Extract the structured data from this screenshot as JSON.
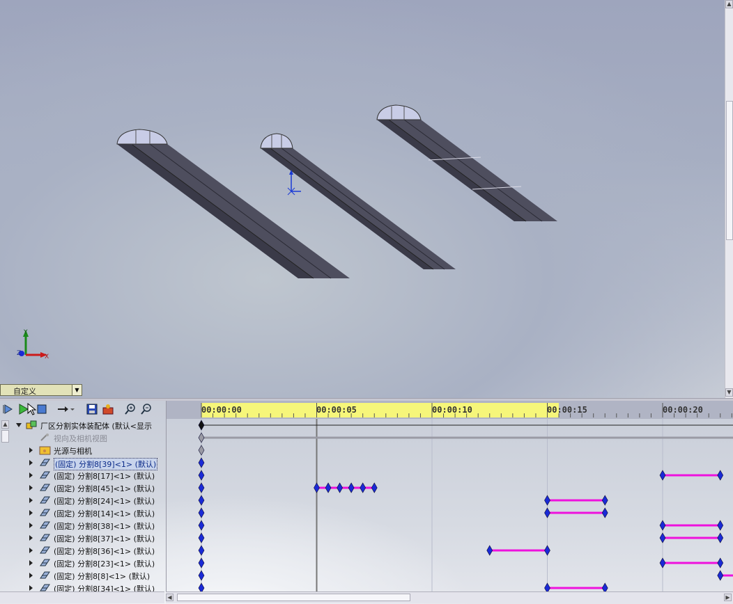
{
  "viewport": {
    "config_selector": "自定义",
    "triad_axes": [
      "Y",
      "X",
      "Z"
    ]
  },
  "motion_toolbar": {
    "buttons": [
      "calculate-icon",
      "play-icon",
      "stop-icon",
      "playback-mode-icon",
      "save-animation-icon",
      "animation-wizard-icon",
      "zoom-in-icon",
      "zoom-out-icon"
    ]
  },
  "tree": {
    "rows": [
      {
        "label": "厂区分割实体装配体 (默认<显示",
        "icon": "assembly-icon",
        "expanded": true
      },
      {
        "label": "视向及相机视图",
        "icon": "camera-view-icon",
        "dimmed": true
      },
      {
        "label": "光源与相机",
        "icon": "lights-folder-icon"
      },
      {
        "label": "(固定) 分割8[39]<1> (默认)",
        "icon": "part-icon",
        "selected": true
      },
      {
        "label": "(固定) 分割8[17]<1> (默认)",
        "icon": "part-icon"
      },
      {
        "label": "(固定) 分割8[45]<1> (默认)",
        "icon": "part-icon"
      },
      {
        "label": "(固定) 分割8[24]<1> (默认)",
        "icon": "part-icon"
      },
      {
        "label": "(固定) 分割8[14]<1> (默认)",
        "icon": "part-icon"
      },
      {
        "label": "(固定) 分割8[38]<1> (默认)",
        "icon": "part-icon"
      },
      {
        "label": "(固定) 分割8[37]<1> (默认)",
        "icon": "part-icon"
      },
      {
        "label": "(固定) 分割8[36]<1> (默认)",
        "icon": "part-icon"
      },
      {
        "label": "(固定) 分割8[23]<1> (默认)",
        "icon": "part-icon"
      },
      {
        "label": "(固定) 分割8[8]<1> (默认)",
        "icon": "part-icon"
      },
      {
        "label": "(固定) 分割8[34]<1> (默认)",
        "icon": "part-icon"
      }
    ]
  },
  "timeline": {
    "tick_labels": [
      "00:00:00",
      "00:00:05",
      "00:00:10",
      "00:00:15",
      "00:00:20"
    ],
    "tick_seconds": [
      0,
      5,
      10,
      15,
      20
    ],
    "visible_range_seconds": [
      0,
      23.1
    ],
    "keyframe_color": "#1a2ad6",
    "bar_color": "#ee11dd",
    "tracks": [
      {
        "keys": [
          0
        ],
        "bars": [],
        "root": true
      },
      {
        "keys": [
          0
        ],
        "bars": [],
        "gray": true
      },
      {
        "keys": [
          0
        ],
        "bars": [],
        "gray": true
      },
      {
        "keys": [
          0
        ],
        "bars": []
      },
      {
        "keys": [
          0,
          20,
          22.5
        ],
        "bars": [
          [
            20,
            22.5
          ]
        ]
      },
      {
        "keys": [
          0,
          5,
          5.5,
          6,
          6.5,
          7,
          7.5
        ],
        "bars": [
          [
            5,
            7.5
          ]
        ]
      },
      {
        "keys": [
          0,
          15,
          17.5
        ],
        "bars": [
          [
            15,
            17.5
          ]
        ]
      },
      {
        "keys": [
          0,
          15,
          17.5
        ],
        "bars": [
          [
            15,
            17.5
          ]
        ]
      },
      {
        "keys": [
          0,
          20,
          22.5
        ],
        "bars": [
          [
            20,
            22.5
          ]
        ]
      },
      {
        "keys": [
          0,
          20,
          22.5
        ],
        "bars": [
          [
            20,
            22.5
          ]
        ]
      },
      {
        "keys": [
          0,
          12.5,
          15
        ],
        "bars": [
          [
            12.5,
            15
          ]
        ]
      },
      {
        "keys": [
          0,
          20,
          22.5
        ],
        "bars": [
          [
            20,
            22.5
          ]
        ]
      },
      {
        "keys": [
          0,
          22.5
        ],
        "bars": [
          [
            22.5,
            23.1
          ]
        ]
      },
      {
        "keys": [
          0,
          15,
          17.5
        ],
        "bars": [
          [
            15,
            17.5
          ]
        ]
      }
    ]
  }
}
